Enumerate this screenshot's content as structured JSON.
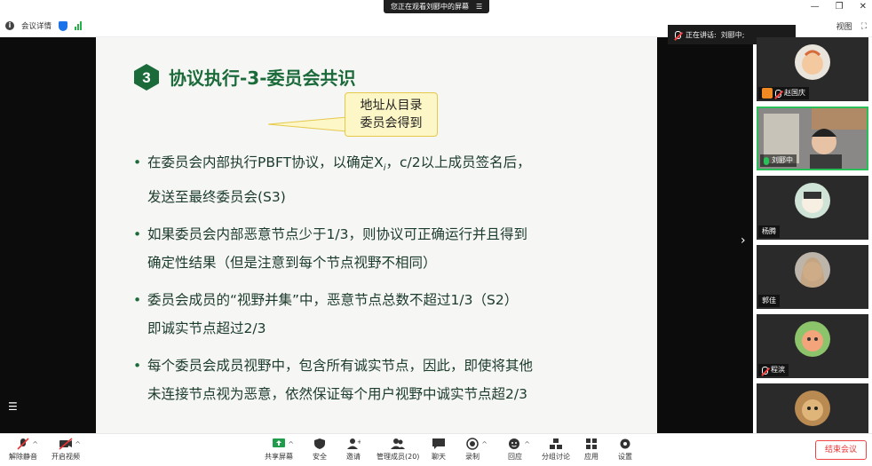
{
  "share_banner": {
    "text": "您正在观看刘郾中的屏幕",
    "icon": "menu-icon"
  },
  "info_bar": {
    "meeting_details": "会议详情",
    "view": "视图"
  },
  "speaking_banner": {
    "label": "正在讲话:",
    "speaker": "刘郾中;"
  },
  "slide": {
    "badge_number": "3",
    "title": "协议执行-3-委员会共识",
    "callout_line1": "地址从目录",
    "callout_line2": "委员会得到",
    "bullets": [
      {
        "line1": "在委员会内部执行PBFT协议，以确定X",
        "line1_sub": "i",
        "line1_tail": "，c/2以上成员签名后，",
        "line2": "发送至最终委员会(S3)"
      },
      {
        "line1": "如果委员会内部恶意节点少于1/3，则协议可正确运行并且得到",
        "line2": "确定性结果（但是注意到每个节点视野不相同）"
      },
      {
        "line1": "委员会成员的“视野并集”中，恶意节点总数不超过1/3（S2）",
        "line2": "即诚实节点超过2/3"
      },
      {
        "line1": "每个委员会成员视野中，包含所有诚实节点，因此，即使将其他",
        "line2": "未连接节点视为恶意，依然保证每个用户视野中诚实节点超2/3"
      }
    ]
  },
  "participants": [
    {
      "name": "赵国庆",
      "muted": true,
      "host": true
    },
    {
      "name": "刘郾中",
      "muted": false,
      "active": true
    },
    {
      "name": "杨腾",
      "muted": false
    },
    {
      "name": "郭佳",
      "muted": false
    },
    {
      "name": "程滨",
      "muted": true
    },
    {
      "name": "",
      "muted": false
    }
  ],
  "toolbar": {
    "unmute": "解除静音",
    "start_video": "开启视频",
    "share_screen": "共享屏幕",
    "security": "安全",
    "invite": "邀请",
    "manage_members": "管理成员(20)",
    "chat": "聊天",
    "record": "录制",
    "reactions": "回应",
    "breakout": "分组讨论",
    "apps": "应用",
    "settings": "设置",
    "end_meeting": "结束会议"
  },
  "colors": {
    "title_green": "#1b6b3a",
    "active_border": "#2bbf5a",
    "end_red": "#e33333"
  }
}
